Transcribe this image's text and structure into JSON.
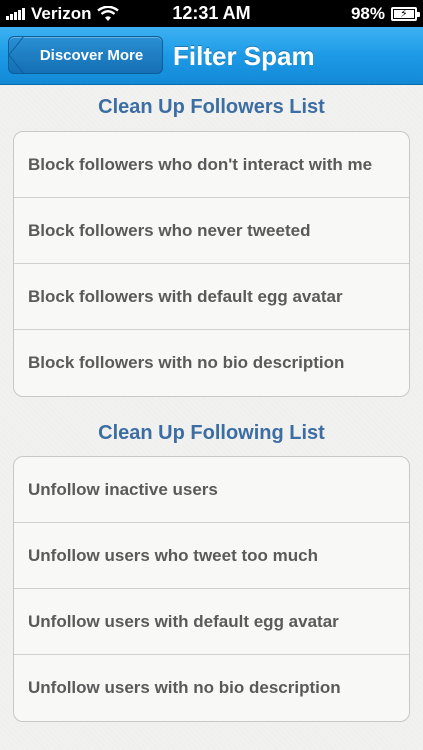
{
  "status_bar": {
    "carrier": "Verizon",
    "time": "12:31 AM",
    "battery": "98%"
  },
  "nav": {
    "back_label": "Discover More",
    "title": "Filter Spam"
  },
  "sections": [
    {
      "header": "Clean Up Followers List",
      "items": [
        "Block followers who don't interact with me",
        "Block followers who never tweeted",
        "Block followers with default egg avatar",
        "Block followers with no bio description"
      ]
    },
    {
      "header": "Clean Up Following List",
      "items": [
        "Unfollow inactive users",
        "Unfollow users who tweet too much",
        "Unfollow users with default egg avatar",
        "Unfollow users with no bio description"
      ]
    }
  ],
  "colors": {
    "nav_blue": "#1d9ae6",
    "section_header": "#3c6da3",
    "row_text": "#5a5a5a"
  }
}
